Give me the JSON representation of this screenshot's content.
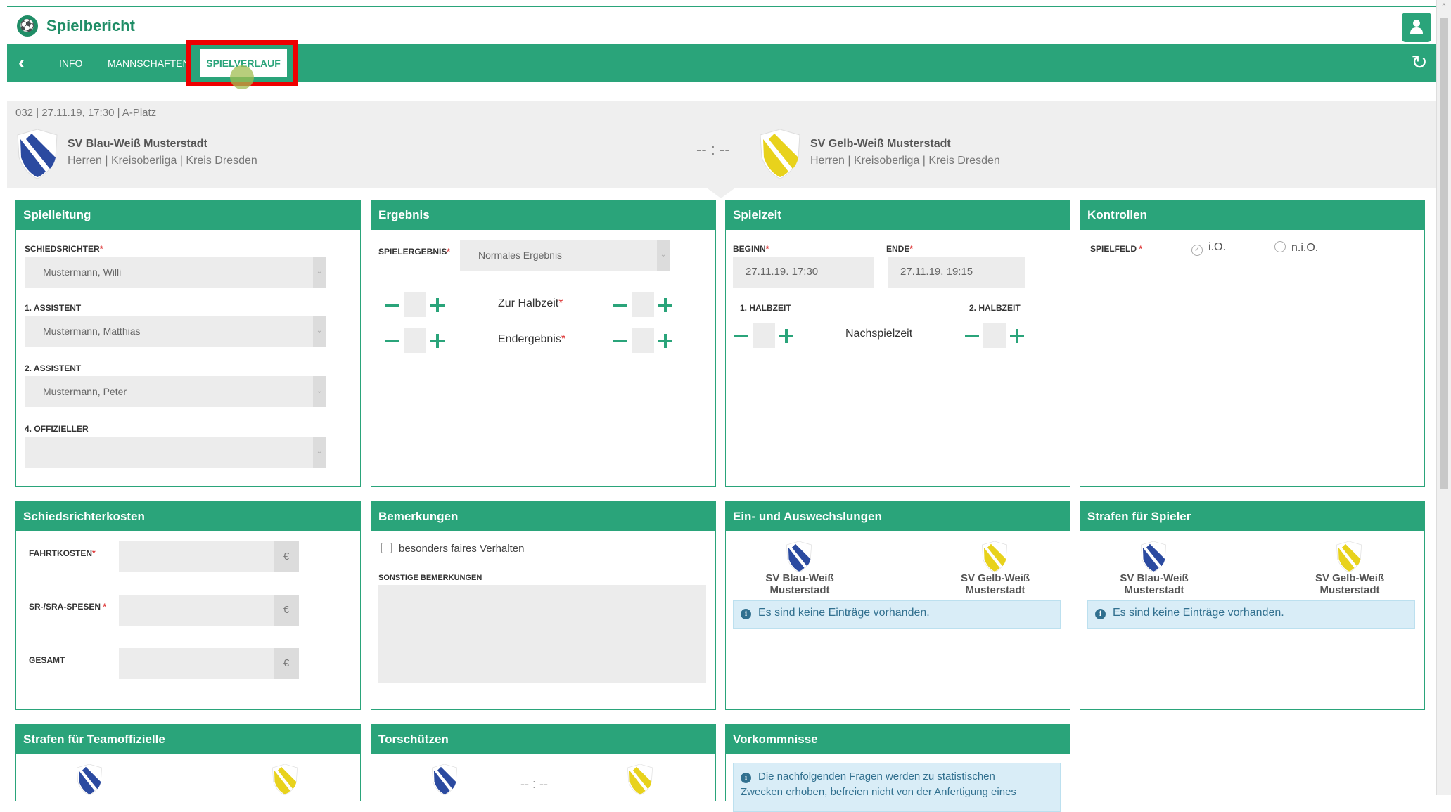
{
  "app": {
    "title": "Spielbericht"
  },
  "nav": {
    "tabs": [
      {
        "label": "INFO"
      },
      {
        "label": "MANNSCHAFTEN"
      },
      {
        "label": "SPIELVERLAUF",
        "active": true
      }
    ]
  },
  "match": {
    "meta": "032 | 27.11.19, 17:30 | A-Platz",
    "home": {
      "name": "SV Blau-Weiß Musterstadt",
      "league": "Herren | Kreisoberliga | Kreis Dresden"
    },
    "away": {
      "name": "SV Gelb-Weiß Musterstadt",
      "league": "Herren | Kreisoberliga | Kreis Dresden"
    },
    "score": "-- : --"
  },
  "spielleitung": {
    "title": "Spielleitung",
    "schiedsrichter_label": "SCHIEDSRICHTER",
    "schiedsrichter_value": "Mustermann, Willi",
    "assistent1_label": "1. ASSISTENT",
    "assistent1_value": "Mustermann, Matthias",
    "assistent2_label": "2. ASSISTENT",
    "assistent2_value": "Mustermann, Peter",
    "offizieller_label": "4. OFFIZIELLER",
    "offizieller_value": ""
  },
  "ergebnis": {
    "title": "Ergebnis",
    "spielergebnis_label": "SPIELERGEBNIS",
    "spielergebnis_value": "Normales Ergebnis",
    "halbzeit_label": "Zur Halbzeit",
    "endergebnis_label": "Endergebnis"
  },
  "spielzeit": {
    "title": "Spielzeit",
    "beginn_label": "BEGINN",
    "beginn_value": "27.11.19. 17:30",
    "ende_label": "ENDE",
    "ende_value": "27.11.19. 19:15",
    "halbzeit1_label": "1. HALBZEIT",
    "halbzeit2_label": "2. HALBZEIT",
    "nachspielzeit_label": "Nachspielzeit"
  },
  "kontrollen": {
    "title": "Kontrollen",
    "spielfeld_label": "SPIELFELD",
    "option_io": "i.O.",
    "option_nio": "n.i.O."
  },
  "kosten": {
    "title": "Schiedsrichterkosten",
    "fahrtkosten_label": "FAHRTKOSTEN",
    "spesen_label": "SR-/SRA-SPESEN",
    "gesamt_label": "GESAMT",
    "currency": "€"
  },
  "bemerkungen": {
    "title": "Bemerkungen",
    "checkbox_label": "besonders faires Verhalten",
    "sonstige_label": "SONSTIGE BEMERKUNGEN"
  },
  "wechsel": {
    "title": "Ein- und Auswechslungen",
    "home_line1": "SV Blau-Weiß",
    "home_line2": "Musterstadt",
    "away_line1": "SV Gelb-Weiß",
    "away_line2": "Musterstadt",
    "empty": "Es sind keine Einträge vorhanden."
  },
  "strafen_spieler": {
    "title": "Strafen für Spieler",
    "home_line1": "SV Blau-Weiß",
    "home_line2": "Musterstadt",
    "away_line1": "SV Gelb-Weiß",
    "away_line2": "Musterstadt",
    "empty": "Es sind keine Einträge vorhanden."
  },
  "strafen_team": {
    "title": "Strafen für Teamoffizielle"
  },
  "torschuetzen": {
    "title": "Torschützen",
    "score": "-- : --"
  },
  "vorkommnisse": {
    "title": "Vorkommnisse",
    "info_line1": "Die nachfolgenden Fragen werden zu statistischen",
    "info_line2": "Zwecken erhoben, befreien nicht von der Anfertigung eines"
  },
  "colors": {
    "accent": "#2aa47a",
    "highlight": "#ee0000",
    "home": "#2b4aa0",
    "away": "#e8d21c"
  }
}
